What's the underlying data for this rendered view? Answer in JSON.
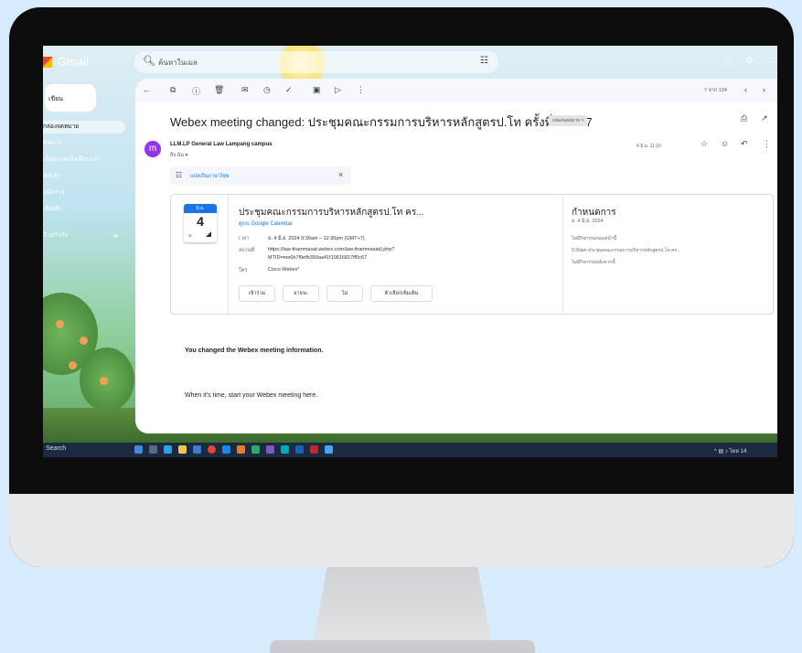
{
  "app": {
    "name": "Gmail"
  },
  "search": {
    "placeholder": "ค้นหาในเมล"
  },
  "sidebar": {
    "compose_label": "เขียน",
    "items": [
      {
        "label": "กล่องจดหมาย"
      },
      {
        "label": "ติดดาว"
      },
      {
        "label": "เลื่อนการแจ้งเตือนแล้ว"
      },
      {
        "label": "ส่งแล้ว"
      },
      {
        "label": "ฉบับร่าง"
      },
      {
        "label": "เพิ่มเติม"
      },
      {
        "label": "ป้ายกำกับ"
      }
    ],
    "add_label": "+"
  },
  "toolbar": {
    "pages": "7 จาก 124"
  },
  "email": {
    "subject": "Webex meeting changed: ประชุมคณะกรรมการบริหารหลักสูตรป.โท ครั้งที่ 4/2567",
    "tag": "กล่องจดหมาย ×",
    "sender": "LLM.LP General Law Lampang campus",
    "to": "ถึง ฉัน ▾",
    "date": "4 มิ.ย. 11:10",
    "avatar_letter": "m",
    "translate": "แปลเป็นภาษาไทย",
    "changed_text": "You changed the Webex meeting information.",
    "when_text": "When it's time, start your Webex meeting here."
  },
  "invite": {
    "month": "มิ.ย.",
    "day": "4",
    "weekday": "อ.",
    "title": "ประชุมคณะกรรมการบริหารหลักสูตรป.โท คร...",
    "calendar_link": "ดูบน Google Calendar",
    "when_label": "เวลา",
    "when_value": "อ. 4 มิ.ย. 2024 9:30am – 12:30pm (GMT+7)",
    "where_label": "สถานที่",
    "where_value_1": "https://law-thammasat.webex.com/law-thammasat/j.php?",
    "where_value_2": "MTID=me6b7f9efb350aa41f10616817ff0c67",
    "who_label": "ใคร",
    "who_value": "Cisco Webex*",
    "rsvp": [
      "เข้าร่วม",
      "อาจจะ",
      "ไม่",
      "ตัวเลือกเพิ่มเติม"
    ],
    "agenda_title": "กำหนดการ",
    "agenda_date": "อ. 4 มิ.ย. 2024",
    "agenda_lines": [
      "ไม่มีกิจกรรมก่อนหน้านี้",
      "9:30am  ประชุมคณะกรรมการบริหารหลักสูตรป.โท คร...",
      "ไม่มีกิจกรรมหลังจากนี้"
    ]
  },
  "taskbar": {
    "search": "Search",
    "time": "ไทย 14"
  },
  "colors": {
    "accent": "#1a73e8",
    "avatar": "#9334e6",
    "taskbar": "#1b2a41"
  }
}
